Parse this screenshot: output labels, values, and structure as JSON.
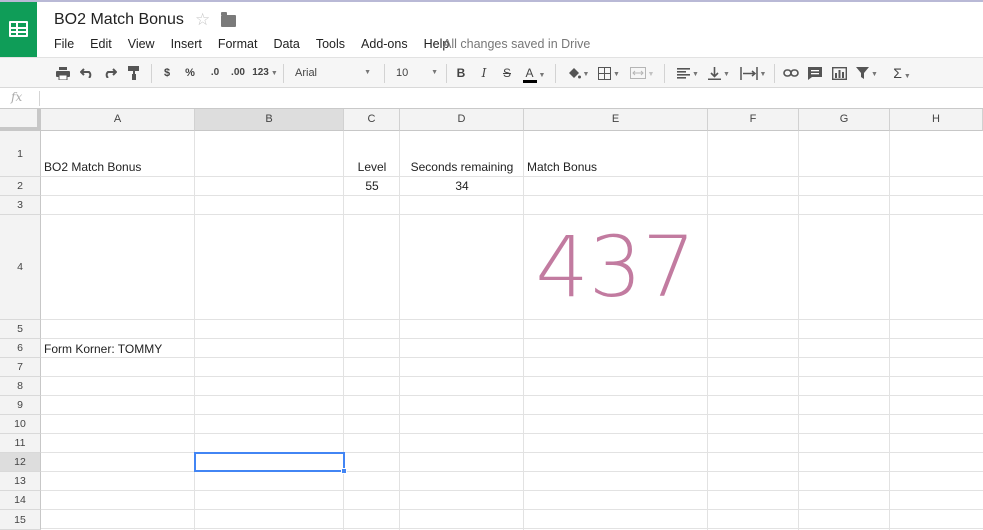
{
  "app": {
    "doc_title": "BO2 Match Bonus",
    "save_status": "All changes saved in Drive",
    "colors": {
      "brand": "#0f9d58",
      "accent": "#4285f4",
      "big_number": "#c27ba0"
    }
  },
  "menu": [
    "File",
    "Edit",
    "View",
    "Insert",
    "Format",
    "Data",
    "Tools",
    "Add-ons",
    "Help"
  ],
  "toolbar": {
    "currency_label": "$",
    "percent_label": "%",
    "decrease_decimal_label": ".0",
    "increase_decimal_label": ".00",
    "more_formats_label": "123",
    "font": "Arial",
    "font_size": "10",
    "bold_label": "B",
    "italic_label": "I",
    "strike_label": "S",
    "text_color_label": "A",
    "sum_label": "Σ",
    "icons": [
      "print-icon",
      "undo-icon",
      "redo-icon",
      "paint-format-icon",
      "fill-color-icon",
      "borders-icon",
      "merge-icon",
      "align-left-icon",
      "valign-bottom-icon",
      "wrap-icon",
      "link-icon",
      "comment-icon",
      "chart-icon",
      "filter-icon",
      "functions-icon"
    ]
  },
  "formula_bar": {
    "fx_label": "fx",
    "value": ""
  },
  "columns": [
    "A",
    "B",
    "C",
    "D",
    "E",
    "F",
    "G",
    "H"
  ],
  "rows": [
    "1",
    "2",
    "3",
    "4",
    "5",
    "6",
    "7",
    "8",
    "9",
    "10",
    "11",
    "12",
    "13",
    "14",
    "15"
  ],
  "cells": {
    "A1": "BO2 Match Bonus",
    "C1": "Level",
    "D1": "Seconds remaining",
    "E1": "Match Bonus",
    "C2": "55",
    "D2": "34",
    "E4": "437",
    "A6": "Form Korner: TOMMY"
  },
  "selected_cell": "B12"
}
